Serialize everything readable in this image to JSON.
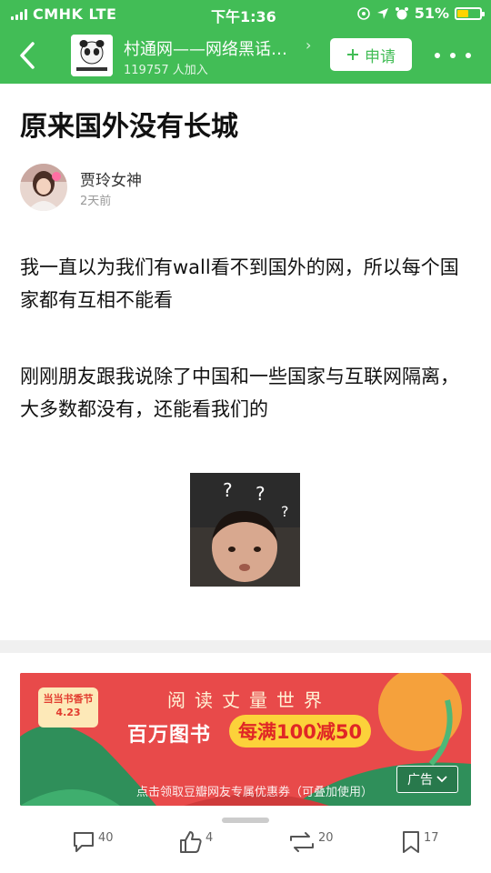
{
  "status_bar": {
    "carrier": "CMHK",
    "network": "LTE",
    "time": "下午1:36",
    "battery_percent": "51%",
    "battery_level": 0.51,
    "icons": [
      "location-icon",
      "alarm-icon",
      "orientation-lock-icon"
    ]
  },
  "navbar": {
    "group_name": "村通网——网络黑话…",
    "member_count": "119757 人加入",
    "apply_label": "申请",
    "colors": {
      "brand": "#42bd56"
    }
  },
  "post": {
    "title": "原来国外没有长城",
    "author": "贾玲女神",
    "posted": "2天前",
    "paragraph1": "我一直以为我们有wall看不到国外的网，所以每个国家都有互相不能看",
    "paragraph2": "刚刚朋友跟我说除了中国和一些国家与互联网隔离，大多数都没有，还能看我们的",
    "meme_marks": "? ?"
  },
  "ad": {
    "logo_line1": "当当书香节",
    "logo_line2": "4.23",
    "headline": "阅读丈量世界",
    "big_text": "百万图书",
    "promo": "每满100减50",
    "subtext": "点击领取豆瓣网友专属优惠券（可叠加使用）",
    "tag": "广告"
  },
  "actions": {
    "comments": "40",
    "likes": "4",
    "reshares": "20",
    "collects": "17"
  }
}
